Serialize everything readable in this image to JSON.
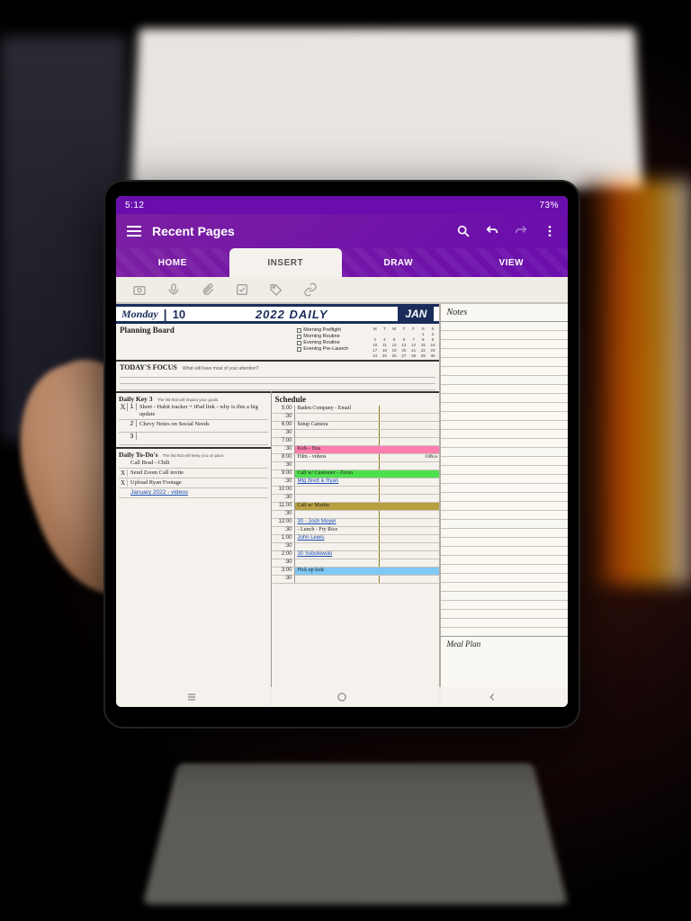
{
  "statusbar": {
    "time": "5:12",
    "battery": "73%"
  },
  "app": {
    "title": "Recent Pages",
    "tabs": [
      "HOME",
      "INSERT",
      "DRAW",
      "VIEW"
    ],
    "active_tab": 1
  },
  "planner": {
    "day": "Monday",
    "date_num": "10",
    "year_title": "2022 DAILY",
    "month": "JAN",
    "planning_board_label": "Planning Board",
    "routines": [
      "Morning Preflight",
      "Morning Routine",
      "Evening Routine",
      "Evening Pre-Launch"
    ],
    "focus": {
      "heading": "TODAY'S FOCUS",
      "sub": "What will have most of your attention?"
    },
    "key3": {
      "heading": "Daily Key 3",
      "sub": "The list that will impact your goals.",
      "items": [
        {
          "x": "X",
          "n": "1",
          "text": "Short - Habit tracker + iPad link - why is this a big update"
        },
        {
          "x": "",
          "n": "2",
          "text": "Chevy Notes on Social Needs"
        },
        {
          "x": "",
          "n": "3",
          "text": ""
        }
      ]
    },
    "todos": {
      "heading": "Daily To-Do's",
      "sub": "The list that will keep you on pace.",
      "items": [
        {
          "x": "",
          "text": "Call Brad - Chili"
        },
        {
          "x": "X",
          "text": "Send Zoom Call invite"
        },
        {
          "x": "X",
          "text": "Upload Ryan Footage"
        },
        {
          "x": "",
          "text": "January 2022 - videos",
          "link": true
        }
      ]
    },
    "schedule": {
      "heading": "Schedule",
      "slots": [
        {
          "t": "5:00",
          "e": "Baden Company - Email",
          "cls": ""
        },
        {
          "t": ":30",
          "e": "",
          "cls": ""
        },
        {
          "t": "6:00",
          "e": "Setup Camera",
          "cls": ""
        },
        {
          "t": ":30",
          "e": "",
          "cls": ""
        },
        {
          "t": "7:00",
          "e": "",
          "cls": ""
        },
        {
          "t": ":30",
          "e": "Kids - Bus",
          "cls": "hl-pink"
        },
        {
          "t": "8:00",
          "e": "Film - videos",
          "cls": "",
          "note": "Office"
        },
        {
          "t": ":30",
          "e": "",
          "cls": ""
        },
        {
          "t": "9:00",
          "e": "Call w/ Customer - Zoom",
          "cls": "hl-green"
        },
        {
          "t": ":30",
          "e": "Mtg Brett & Ryan",
          "cls": "",
          "link": true
        },
        {
          "t": "10:00",
          "e": "",
          "cls": ""
        },
        {
          "t": ":30",
          "e": "",
          "cls": ""
        },
        {
          "t": "11:00",
          "e": "Call w/ Martin",
          "cls": "hl-olive"
        },
        {
          "t": ":30",
          "e": "",
          "cls": ""
        },
        {
          "t": "12:00",
          "e": "30 - Josh Moyer",
          "cls": "",
          "link": true
        },
        {
          "t": ":30",
          "e": "- Lunch - Fry Rice",
          "cls": ""
        },
        {
          "t": "1:00",
          "e": "John Lewis",
          "cls": "",
          "link": true
        },
        {
          "t": ":30",
          "e": "",
          "cls": ""
        },
        {
          "t": "2:00",
          "e": "30 Sobolewski",
          "cls": "",
          "link": true
        },
        {
          "t": ":30",
          "e": "",
          "cls": ""
        },
        {
          "t": "3:00",
          "e": "Pick up kids",
          "cls": "hl-blue"
        },
        {
          "t": ":30",
          "e": "",
          "cls": ""
        }
      ]
    },
    "notes_label": "Notes",
    "meal_label": "Meal Plan"
  }
}
